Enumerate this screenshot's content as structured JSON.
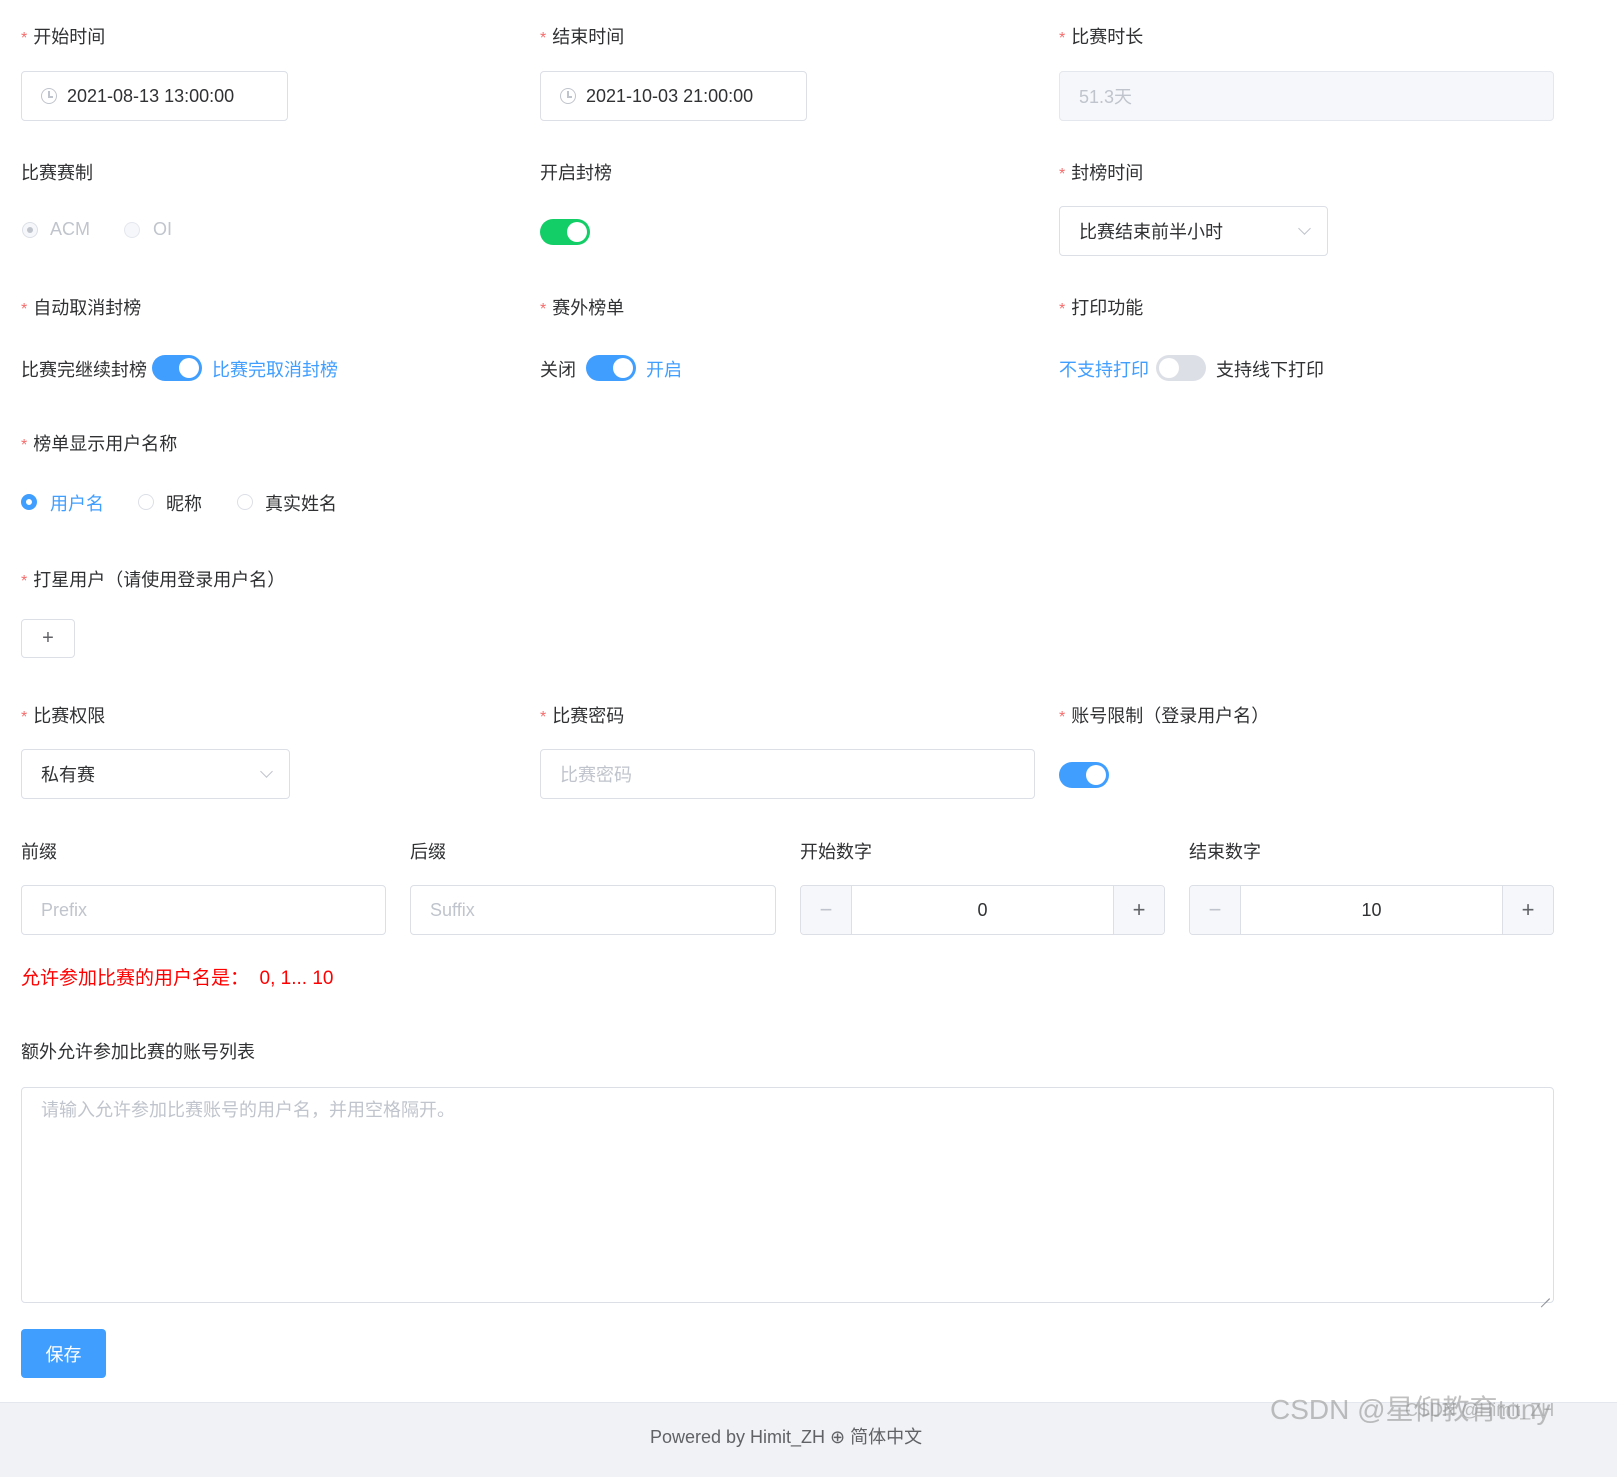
{
  "row1": {
    "start_label": "开始时间",
    "start_value": "2021-08-13 13:00:00",
    "end_label": "结束时间",
    "end_value": "2021-10-03 21:00:00",
    "duration_label": "比赛时长",
    "duration_value": "51.3天"
  },
  "row2": {
    "format_label": "比赛赛制",
    "format_options": [
      "ACM",
      "OI"
    ],
    "format_selected": "ACM",
    "seal_label": "开启封榜",
    "seal_enabled": true,
    "seal_time_label": "封榜时间",
    "seal_time_value": "比赛结束前半小时"
  },
  "row3": {
    "auto_unseal_label": "自动取消封榜",
    "auto_unseal_off_text": "比赛完继续封榜",
    "auto_unseal_on_text": "比赛完取消封榜",
    "auto_unseal_enabled": true,
    "outside_rank_label": "赛外榜单",
    "outside_rank_off_text": "关闭",
    "outside_rank_on_text": "开启",
    "outside_rank_enabled": true,
    "print_label": "打印功能",
    "print_off_text": "不支持打印",
    "print_on_text": "支持线下打印",
    "print_enabled": false
  },
  "rank_display": {
    "label": "榜单显示用户名称",
    "options": [
      "用户名",
      "昵称",
      "真实姓名"
    ],
    "selected": "用户名"
  },
  "star_users": {
    "label": "打星用户（请使用登录用户名）",
    "add_symbol": "+"
  },
  "row_auth": {
    "auth_label": "比赛权限",
    "auth_value": "私有赛",
    "password_label": "比赛密码",
    "password_placeholder": "比赛密码",
    "account_limit_label": "账号限制（登录用户名）",
    "account_limit_enabled": true
  },
  "row_range": {
    "prefix_label": "前缀",
    "prefix_placeholder": "Prefix",
    "suffix_label": "后缀",
    "suffix_placeholder": "Suffix",
    "start_num_label": "开始数字",
    "start_num_value": "0",
    "end_num_label": "结束数字",
    "end_num_value": "10",
    "minus_symbol": "−",
    "plus_symbol": "+"
  },
  "allowed_text": "允许参加比赛的用户名是：  0, 1... 10",
  "extra_accounts": {
    "label": "额外允许参加比赛的账号列表",
    "placeholder": "请输入允许参加比赛账号的用户名，并用空格隔开。"
  },
  "save_label": "保存",
  "footer_text": "Powered by Himit_ZH  ⊕ 简体中文",
  "watermark_text": "CSDN @星仰教育tony",
  "watermark_sub": "CSDN @Himit_ZH",
  "colors": {
    "primary": "#409eff",
    "success": "#13ce66",
    "danger": "#ff0000",
    "required": "#f56c6c"
  }
}
